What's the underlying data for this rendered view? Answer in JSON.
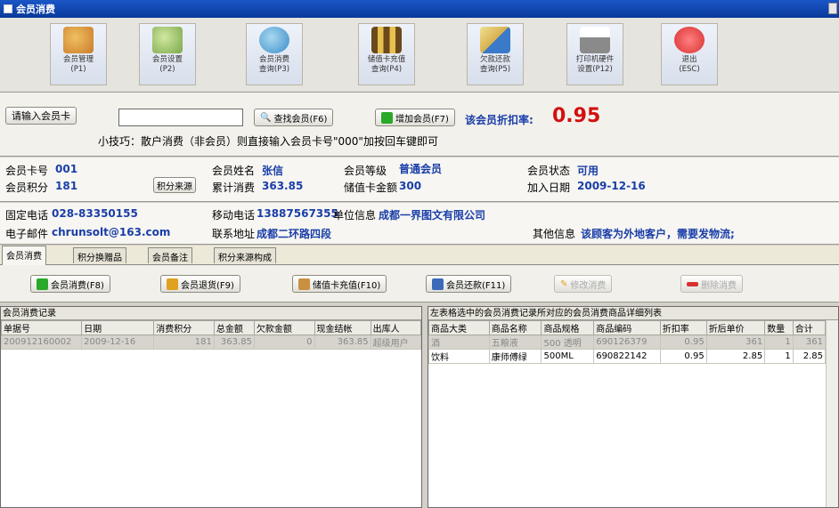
{
  "window": {
    "title": "会员消费"
  },
  "toolbar": [
    {
      "label": "会员管理\n(P1)",
      "color": "#c97b2a"
    },
    {
      "label": "会员设置\n(P2)",
      "color": "#7aa84a"
    },
    {
      "label": "会员消费\n查询(P3)",
      "color": "#3a8cc8"
    },
    {
      "label": "储值卡充值\n查询(P4)",
      "color": "#b8862a"
    },
    {
      "label": "欠款还款\n查询(P5)",
      "color": "#d8b050"
    },
    {
      "label": "打印机硬件\n设置(P12)",
      "color": "#8a8a8a"
    },
    {
      "label": "退出\n(ESC)",
      "color": "#d83030"
    }
  ],
  "search": {
    "label": "请输入会员卡",
    "value": "",
    "find_button": "查找会员(F6)",
    "add_button": "增加会员(F7)",
    "discount_label": "该会员折扣率:",
    "discount_value": "0.95",
    "tip": "小技巧：散户消费（非会员）则直接输入会员卡号\"000\"加按回车键即可"
  },
  "member": {
    "card_label": "会员卡号",
    "card_value": "001",
    "name_label": "会员姓名",
    "name_value": "张信",
    "level_label": "会员等级",
    "level_value": "普通会员",
    "status_label": "会员状态",
    "status_value": "可用",
    "points_label": "会员积分",
    "points_value": "181",
    "points_source_button": "积分来源",
    "total_label": "累计消费",
    "total_value": "363.85",
    "balance_label": "储值卡金额",
    "balance_value": "300",
    "join_label": "加入日期",
    "join_value": "2009-12-16"
  },
  "contact": {
    "phone_label": "固定电话",
    "phone_value": "028-83350155",
    "mobile_label": "移动电话",
    "mobile_value": "13887567355",
    "company_label": "单位信息",
    "company_value": "成都一界图文有限公司",
    "email_label": "电子邮件",
    "email_value": "chrunsolt@163.com",
    "address_label": "联系地址",
    "address_value": "成都二环路四段",
    "other_label": "其他信息",
    "other_value": "该顾客为外地客户，需要发物流;"
  },
  "tabs": [
    "会员消费",
    "积分换赠品",
    "会员备注",
    "积分来源构成"
  ],
  "actions": {
    "consume": "会员消费(F8)",
    "return": "会员退货(F9)",
    "recharge": "储值卡充值(F10)",
    "repay": "会员还款(F11)",
    "edit": "修改消费",
    "delete": "删除消费"
  },
  "left_grid": {
    "title": "会员消费记录",
    "columns": [
      "单据号",
      "日期",
      "消费积分",
      "总金额",
      "欠款金额",
      "现金结帐",
      "出库人"
    ],
    "rows": [
      [
        "200912160002",
        "2009-12-16",
        "181",
        "363.85",
        "0",
        "363.85",
        "超级用户"
      ]
    ]
  },
  "right_grid": {
    "title": "左表格选中的会员消费记录所对应的会员消费商品详细列表",
    "columns": [
      "商品大类",
      "商品名称",
      "商品规格",
      "商品编码",
      "折扣率",
      "折后单价",
      "数量",
      "合计"
    ],
    "rows": [
      [
        "酒",
        "五粮液",
        "500 透明",
        "690126379",
        "0.95",
        "361",
        "1",
        "361"
      ],
      [
        "饮料",
        "康师傅绿",
        "500ML",
        "690822142",
        "0.95",
        "2.85",
        "1",
        "2.85"
      ]
    ]
  }
}
